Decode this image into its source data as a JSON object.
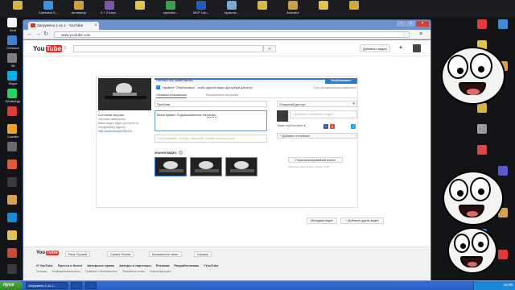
{
  "desktop": {
    "top_icons": [
      {
        "label": "",
        "color": "#d8b24a"
      },
      {
        "label": "Camtasia S...",
        "color": "#3d8fe0"
      },
      {
        "label": "активатор",
        "color": "#caa03d"
      },
      {
        "label": "4 + 2 Блут...",
        "color": "#7a5aa8"
      },
      {
        "label": "",
        "color": "#e0c452"
      },
      {
        "label": "speedsh...",
        "color": "#36a04a"
      },
      {
        "label": "MCP Lab...",
        "color": "#1f5fb6"
      },
      {
        "label": "мультик...",
        "color": "#7aa8d0"
      },
      {
        "label": "",
        "color": "#d7b84a"
      },
      {
        "label": "Activator",
        "color": "#c8a040"
      },
      {
        "label": "",
        "color": "#e0c452"
      },
      {
        "label": "",
        "color": "#d0a63c"
      }
    ],
    "left_icons": [
      {
        "label": "Мой",
        "color": "#f2f2f2"
      },
      {
        "label": "Сетевое",
        "color": "#3f7fd4"
      },
      {
        "label": "3D",
        "color": "#7d7d7d"
      },
      {
        "label": "Skype",
        "color": "#00aff0"
      },
      {
        "label": "WhatsApp",
        "color": "#25d366"
      },
      {
        "label": "",
        "color": "#e03a3a"
      },
      {
        "label": "Counter",
        "color": "#f0a030"
      },
      {
        "label": "",
        "color": "#6a6a6a"
      },
      {
        "label": "",
        "color": "#e05a3a"
      },
      {
        "label": "",
        "color": "#3a3a3a"
      },
      {
        "label": "",
        "color": "#d8a050"
      },
      {
        "label": "",
        "color": "#1b8bd8"
      },
      {
        "label": "",
        "color": "#e0c452"
      },
      {
        "label": "",
        "color": "#c84a3a"
      },
      {
        "label": "",
        "color": "#3a3a3a"
      }
    ],
    "right_icons": [
      {
        "label": "",
        "color": "#e03a3a"
      },
      {
        "label": "",
        "color": "#3a8fd8"
      },
      {
        "label": "",
        "color": "#e0c452"
      },
      {
        "label": "",
        "color": "#d8a050"
      },
      {
        "label": "",
        "color": "#3ab050"
      },
      {
        "label": "",
        "color": "#d8b24a"
      },
      {
        "label": "",
        "color": "#9a9a9a"
      },
      {
        "label": "",
        "color": "#d84a4a"
      },
      {
        "label": "",
        "color": "#5a5ad8"
      },
      {
        "label": "",
        "color": "#d8b24a"
      },
      {
        "label": "",
        "color": "#e0c452"
      },
      {
        "label": "",
        "color": "#d8a050"
      },
      {
        "label": "",
        "color": "#3a8fd8"
      },
      {
        "label": "",
        "color": "#e03a3a"
      }
    ]
  },
  "browser": {
    "tab_title": "Загружено 1 из 1 - YouTube",
    "url": "www.youtube.com",
    "close_glyph": "x"
  },
  "youtube": {
    "logo_you": "You",
    "logo_tube": "Tube",
    "upload_button": "Добавить видео",
    "status_label": "ОБРАБОТКА ЗАВЕРШЕНА",
    "publish_button": "Опубликовать",
    "notice_text": "Нажмите \"Опубликовать\", чтобы сделать видео доступным для всех.",
    "notice_right": "Есть несохраненные изменения",
    "tab_basic": "Основная информация",
    "tab_advanced": "Расширенные настройки",
    "title_value": "Пробная",
    "description_prefix": "Всем привет Подписывайтесь на ",
    "description_error": "канал",
    "tags_placeholder": "Теги (например, Альберт Эйнштейн, модный дом пистолет)",
    "privacy_value": "Открытый доступ",
    "share_placeholder": "+ Добавить сообщение к видео",
    "share_label": "Также опубликовать в",
    "playlist_button": "+ Добавить в плейлист",
    "thumbs_label": "ЗНАЧКИ ВИДЕО",
    "custom_thumb_button": "Персонализированный значок",
    "custom_thumb_note": "Максимальный размер файла: 2 МБ",
    "meta_status": "Состояние загрузки:",
    "meta_lines": [
      "Загрузка завершена!",
      "Ваше видео будет доступно по",
      "следующему адресу:"
    ],
    "meta_link": "http://youtu.be/xq0O0kzCA",
    "edit_button": "Менеджер видео",
    "add_more_button": "+ Добавить другие видео"
  },
  "footer": {
    "logo_you": "You",
    "logo_tube": "Tube",
    "language": "Язык: Русский",
    "country": "Страна: Россия",
    "safety": "Безопасность: выкл.",
    "help": "Справка",
    "links": [
      "О YouTube",
      "Пресса и блоги",
      "Авторское право",
      "Авторы и партнеры",
      "Реклама",
      "Разработчикам",
      "+YouTube"
    ],
    "links2": [
      "Условия",
      "Конфиденциальность",
      "Правила и безопасность",
      "Отправить отзыв",
      "Новые функции!"
    ]
  },
  "taskbar": {
    "start_label": "пуск",
    "tasks": [
      "Загружено 1 из 1...",
      "",
      ""
    ],
    "clock": "12:00"
  },
  "colors": {
    "youtube_red": "#e52d27",
    "publish_blue": "#2d7bd0",
    "taskbar_blue": "#255fc4"
  }
}
